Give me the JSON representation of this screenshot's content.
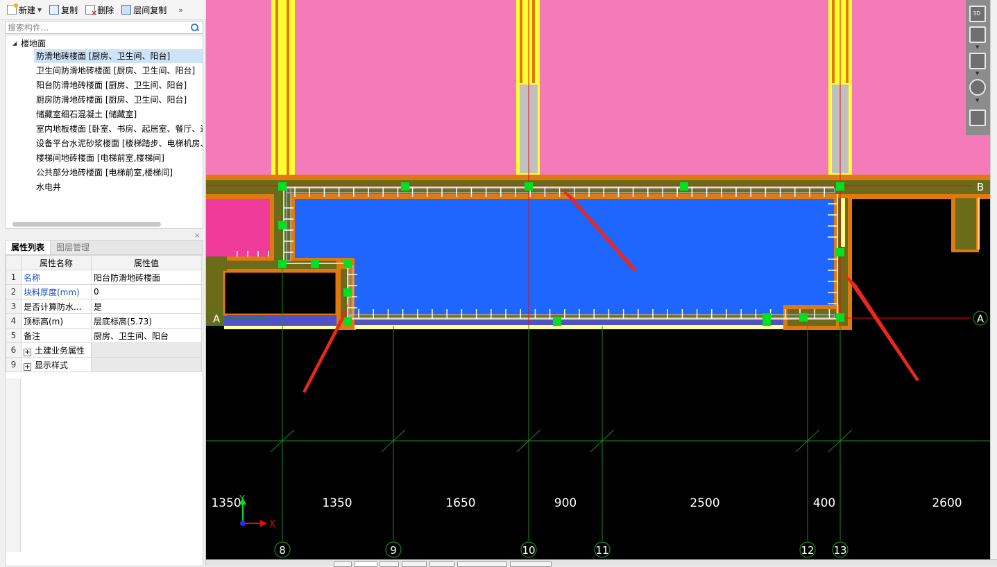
{
  "toolbar": {
    "new_label": "新建",
    "copy_label": "复制",
    "delete_label": "删除",
    "floor_copy_label": "层间复制",
    "more": "»"
  },
  "search": {
    "placeholder": "搜索构件..."
  },
  "tree": {
    "root_label": "楼地面",
    "items": [
      "防滑地砖楼面 [厨房、卫生间、阳台]",
      "卫生间防滑地砖楼面 [厨房、卫生间、阳台]",
      "阳台防滑地砖楼面 [厨房、卫生间、阳台]",
      "厨房防滑地砖楼面 [厨房、卫生间、阳台]",
      "储藏室细石混凝土 [储藏室]",
      "室内地板楼面 [卧室、书房、起居室、餐厅、过",
      "设备平台水泥砂浆楼面 [楼梯踏步、电梯机房、",
      "楼梯间地砖楼面 [电梯前室,楼梯间]",
      "公共部分地砖楼面 [电梯前室,楼梯间]",
      "水电井"
    ]
  },
  "props": {
    "tab_props": "属性列表",
    "tab_layers": "图层管理",
    "col_name": "属性名称",
    "col_value": "属性值",
    "rows": [
      {
        "num": "1",
        "name": "名称",
        "value": "阳台防滑地砖楼面"
      },
      {
        "num": "2",
        "name": "块料厚度(mm)",
        "value": "0"
      },
      {
        "num": "3",
        "name": "是否计算防水...",
        "value": "是"
      },
      {
        "num": "4",
        "name": "顶标高(m)",
        "value": "层底标高(5.73)"
      },
      {
        "num": "5",
        "name": "备注",
        "value": "厨房、卫生间、阳台"
      },
      {
        "num": "6",
        "name": "土建业务属性",
        "value": ""
      },
      {
        "num": "9",
        "name": "显示样式",
        "value": ""
      }
    ]
  },
  "canvas": {
    "axis_row_a": "A",
    "axis_row_b": "B",
    "dimensions": [
      "1350",
      "1350",
      "1650",
      "900",
      "2500",
      "400",
      "2600"
    ],
    "grid_labels": [
      "8",
      "9",
      "10",
      "11",
      "12",
      "13"
    ],
    "ucs_x": "X",
    "ucs_y": "Y",
    "view_3d_label": "3D"
  },
  "colors": {
    "canvas_bg": "#000000",
    "room_pink": "#f47bb8",
    "balcony_blue": "#1f66ff",
    "wall_orange": "#e07a10",
    "wall_olive": "#6b6b1a",
    "column_yellow": "#ffff33",
    "grip_green": "#00e020",
    "arrow_red": "#e8281e",
    "axis_green": "#1f8a1f",
    "axis_red": "#e01010"
  }
}
